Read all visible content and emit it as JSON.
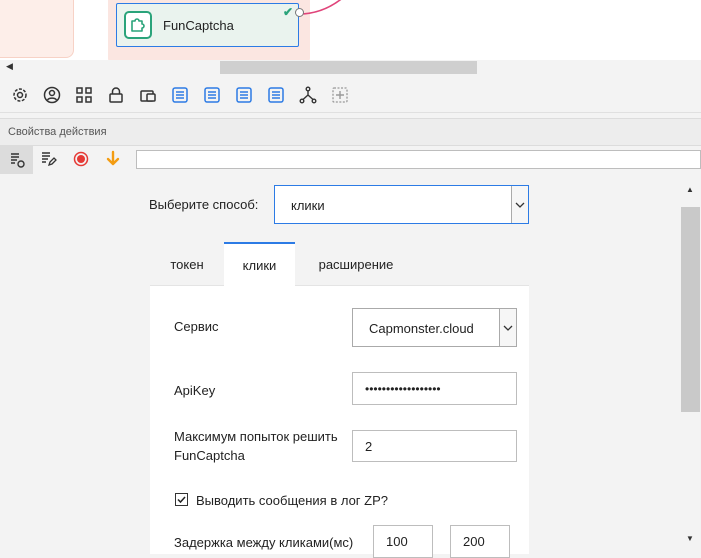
{
  "canvas": {
    "node_title": "FunCaptcha"
  },
  "section": {
    "title": "Свойства действия"
  },
  "method": {
    "label": "Выберите способ:",
    "value": "клики"
  },
  "tabs": [
    {
      "label": "токен"
    },
    {
      "label": "клики"
    },
    {
      "label": "расширение"
    }
  ],
  "form": {
    "service_label": "Сервис",
    "service_value": "Capmonster.cloud",
    "apikey_label": "ApiKey",
    "apikey_value": "••••••••••••••••••",
    "attempts_label_1": "Максимум попыток решить",
    "attempts_label_2": "FunCaptcha",
    "attempts_value": "2",
    "log_label": "Выводить сообщения в лог ZP?",
    "log_checked": true,
    "delay_label": "Задержка между кликами(мс)",
    "delay_min": "100",
    "delay_max": "200"
  },
  "colors": {
    "accent": "#2c7be5",
    "node_icon": "#2aa37a",
    "record": "#e53935",
    "arrow": "#f39c12",
    "link": "#e0447a"
  }
}
